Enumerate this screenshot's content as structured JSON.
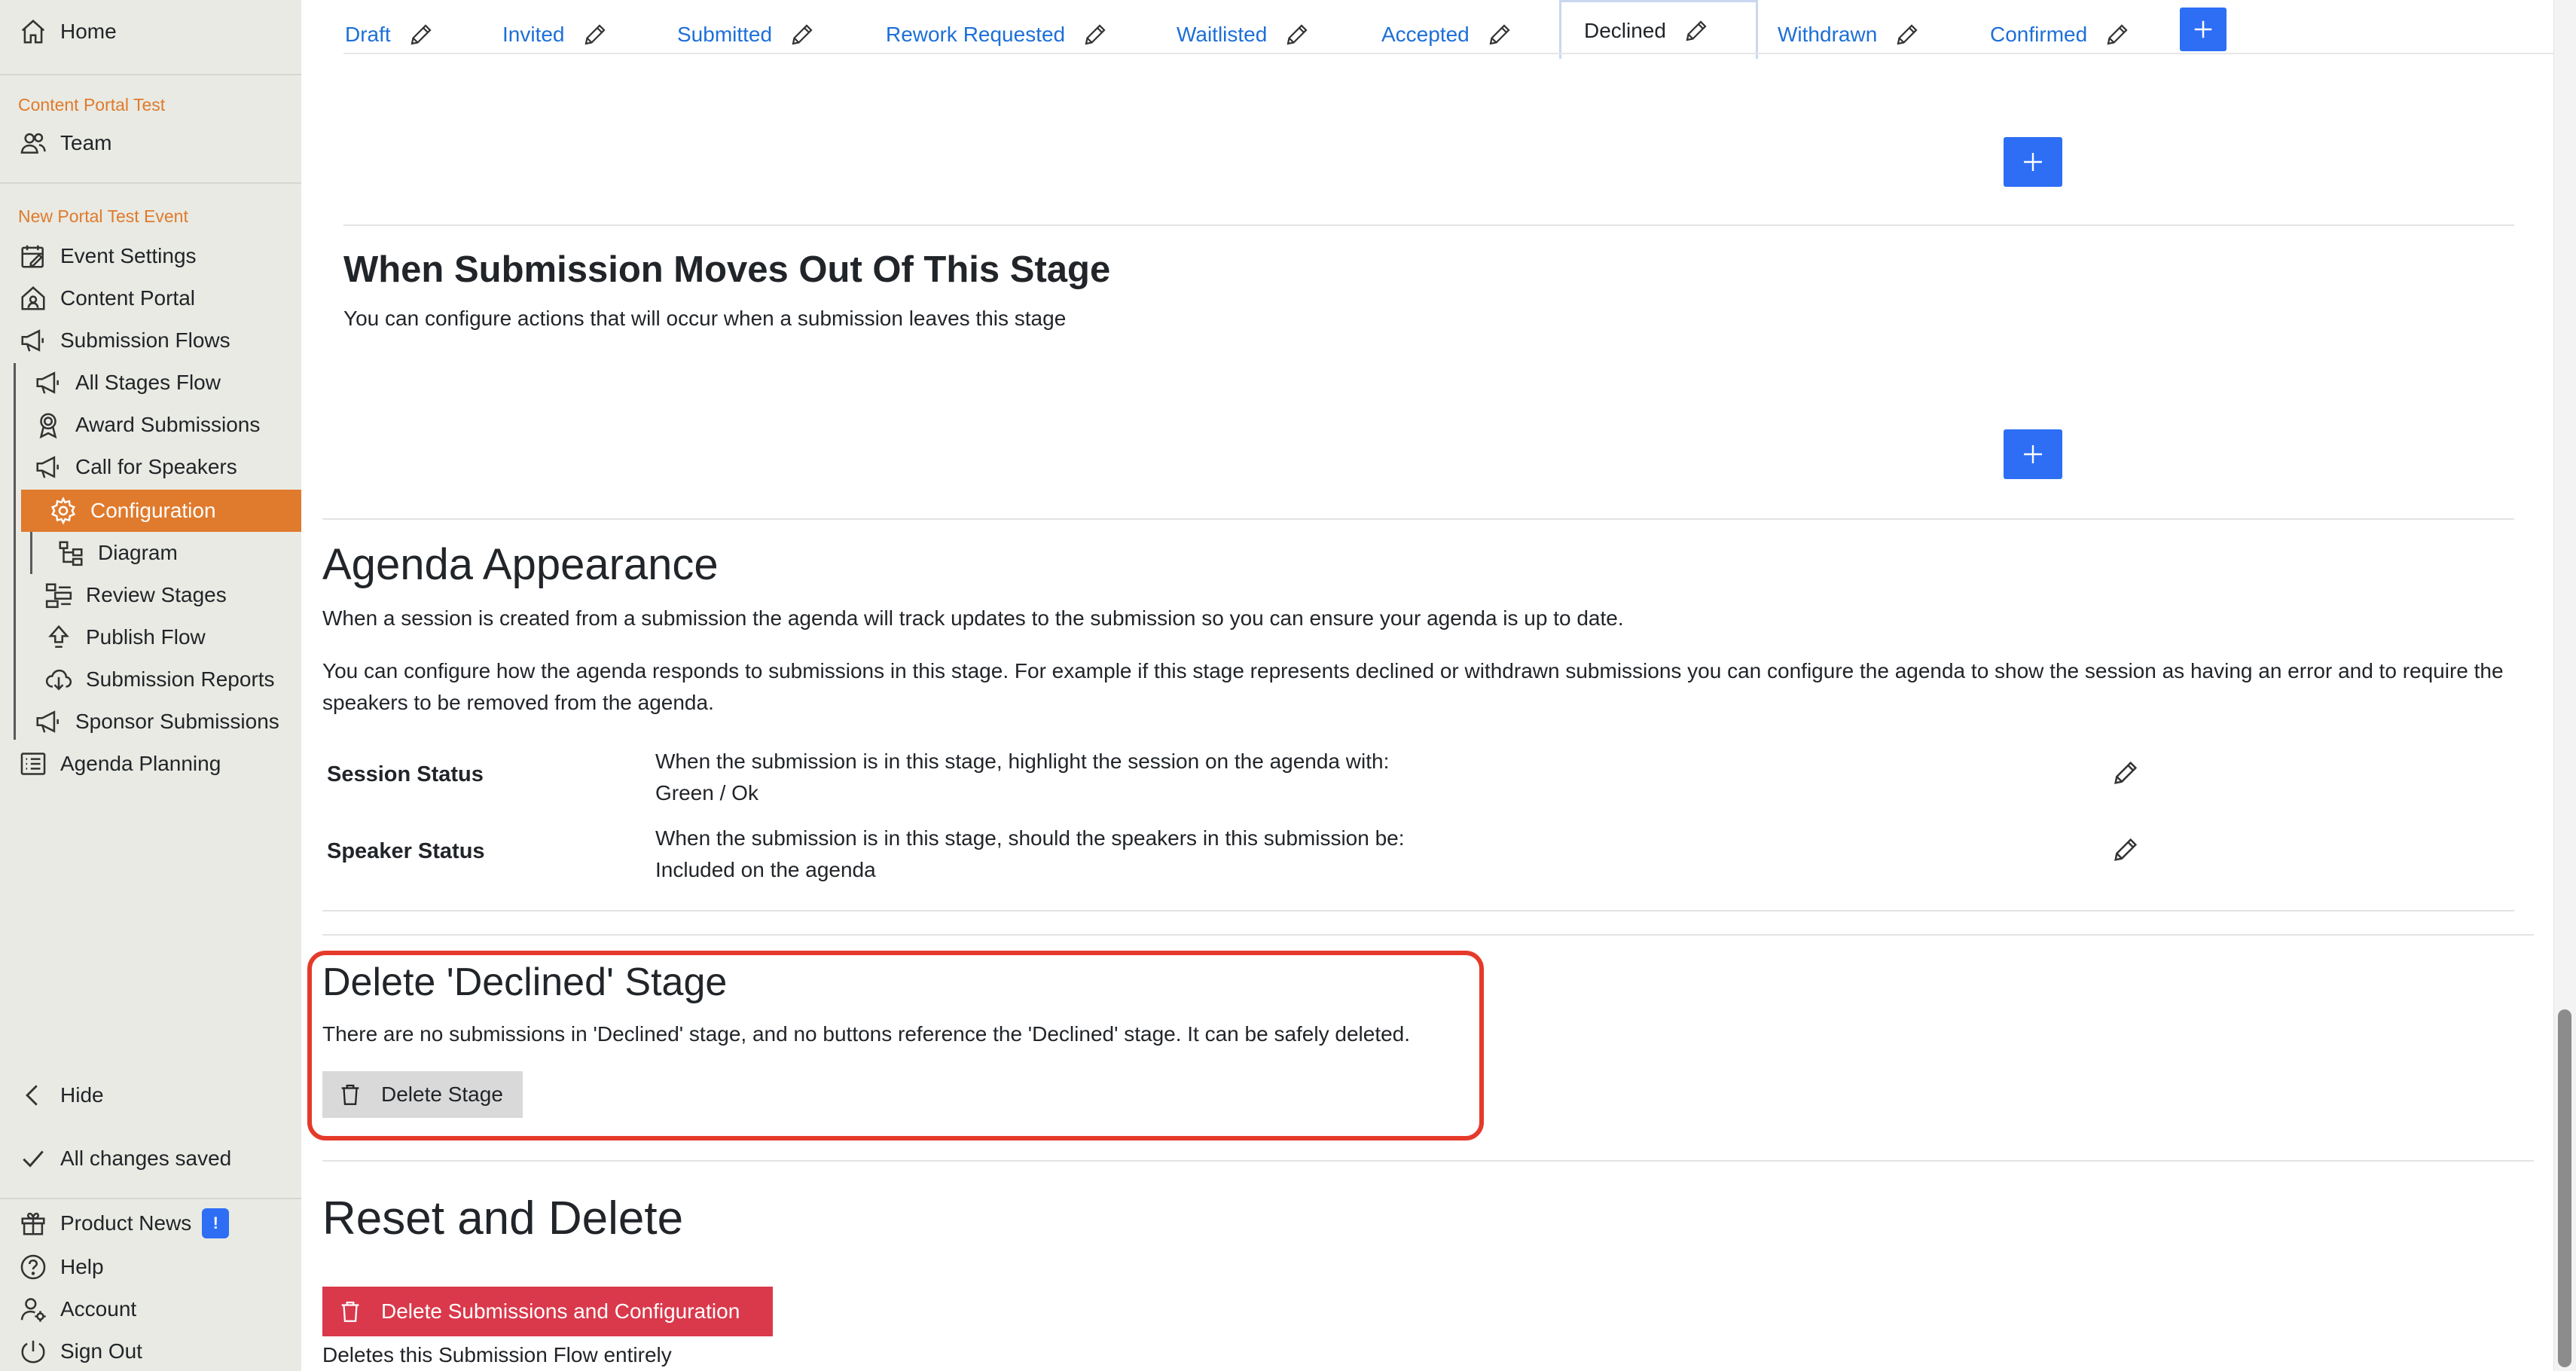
{
  "sidebar": {
    "home": "Home",
    "section_content": "Content Portal Test",
    "team": "Team",
    "section_event": "New Portal Test Event",
    "event_settings": "Event Settings",
    "content_portal": "Content Portal",
    "submission_flows": "Submission Flows",
    "all_stages_flow": "All Stages Flow",
    "award_submissions": "Award Submissions",
    "call_for_speakers": "Call for Speakers",
    "configuration": "Configuration",
    "diagram": "Diagram",
    "review_stages": "Review Stages",
    "publish_flow": "Publish Flow",
    "submission_reports": "Submission Reports",
    "sponsor_submissions": "Sponsor Submissions",
    "agenda_planning": "Agenda Planning",
    "hide": "Hide",
    "all_changes_saved": "All changes saved",
    "product_news": "Product News",
    "product_news_badge": "!",
    "help": "Help",
    "account": "Account",
    "sign_out": "Sign Out"
  },
  "tabs": [
    {
      "label": "Draft",
      "active": false
    },
    {
      "label": "Invited",
      "active": false
    },
    {
      "label": "Submitted",
      "active": false
    },
    {
      "label": "Rework Requested",
      "active": false
    },
    {
      "label": "Waitlisted",
      "active": false
    },
    {
      "label": "Accepted",
      "active": false
    },
    {
      "label": "Declined",
      "active": true
    },
    {
      "label": "Withdrawn",
      "active": false
    },
    {
      "label": "Confirmed",
      "active": false
    }
  ],
  "move_out": {
    "title": "When Submission Moves Out Of This Stage",
    "description": "You can configure actions that will occur when a submission leaves this stage"
  },
  "agenda": {
    "title": "Agenda Appearance",
    "para1": "When a session is created from a submission the agenda will track updates to the submission so you can ensure your agenda is up to date.",
    "para2": "You can configure how the agenda responds to submissions in this stage. For example if this stage represents declined or withdrawn submissions you can configure the agenda to show the session as having an error and to require the speakers to be removed from the agenda.",
    "session_status_label": "Session Status",
    "session_status_question": "When the submission is in this stage, highlight the session on the agenda with:",
    "session_status_value": "Green / Ok",
    "speaker_status_label": "Speaker Status",
    "speaker_status_question": "When the submission is in this stage, should the speakers in this submission be:",
    "speaker_status_value": "Included on the agenda"
  },
  "delete_stage": {
    "title": "Delete 'Declined' Stage",
    "description": "There are no submissions in 'Declined' stage, and no buttons reference the 'Declined' stage. It can be safely deleted.",
    "button": "Delete Stage"
  },
  "reset": {
    "title": "Reset and Delete",
    "button": "Delete Submissions and Configuration",
    "note": "Deletes this Submission Flow entirely"
  },
  "colors": {
    "accent_orange": "#e07a2c",
    "primary_blue": "#2d6ef5",
    "danger_red": "#d9394b",
    "highlight_red": "#e53a2b"
  }
}
